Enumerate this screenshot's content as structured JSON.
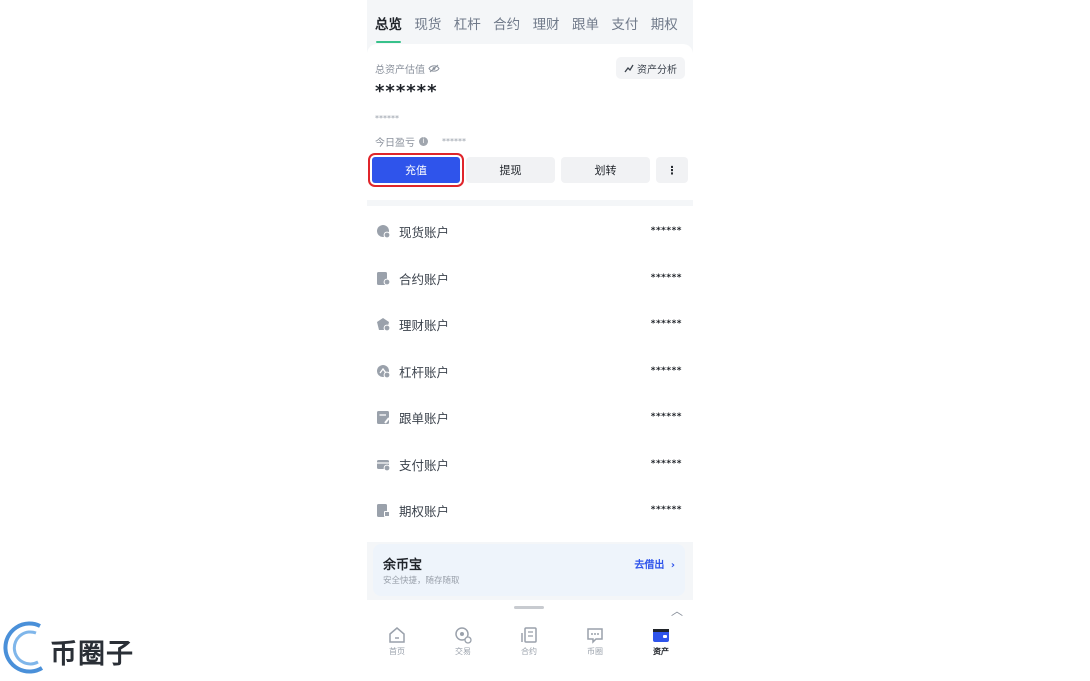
{
  "tabs": [
    "总览",
    "现货",
    "杠杆",
    "合约",
    "理财",
    "跟单",
    "支付",
    "期权"
  ],
  "overview": {
    "total_label": "总资产估值",
    "analysis_label": "资产分析",
    "total_value": "******",
    "sub_value": "******",
    "pnl_label": "今日盈亏",
    "pnl_value": "******"
  },
  "actions": {
    "deposit": "充值",
    "withdraw": "提现",
    "transfer": "划转",
    "more": "⋮"
  },
  "accounts": [
    {
      "label": "现货账户",
      "value": "******",
      "icon": "spot-account-icon"
    },
    {
      "label": "合约账户",
      "value": "******",
      "icon": "contract-account-icon"
    },
    {
      "label": "理财账户",
      "value": "******",
      "icon": "earn-account-icon"
    },
    {
      "label": "杠杆账户",
      "value": "******",
      "icon": "margin-account-icon"
    },
    {
      "label": "跟单账户",
      "value": "******",
      "icon": "copy-trade-account-icon"
    },
    {
      "label": "支付账户",
      "value": "******",
      "icon": "payment-account-icon"
    },
    {
      "label": "期权账户",
      "value": "******",
      "icon": "options-account-icon"
    }
  ],
  "yubibao": {
    "title": "余币宝",
    "subtitle": "安全快捷，随存随取",
    "link": "去借出"
  },
  "bottom_nav": [
    {
      "label": "首页",
      "icon": "home-icon"
    },
    {
      "label": "交易",
      "icon": "trade-icon"
    },
    {
      "label": "合约",
      "icon": "contract-icon"
    },
    {
      "label": "币圈",
      "icon": "community-icon"
    },
    {
      "label": "资产",
      "icon": "wallet-icon",
      "active": true
    }
  ],
  "watermark": "币圈子",
  "colors": {
    "primary": "#2f54eb",
    "highlight_border": "#e0252b",
    "tab_underline": "#37c18a"
  }
}
